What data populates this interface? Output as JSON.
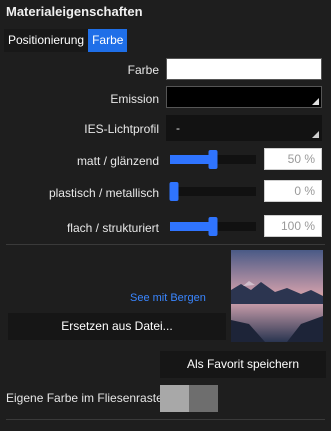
{
  "panel": {
    "title": "Materialeigenschaften"
  },
  "tabs": [
    {
      "label": "Positionierung",
      "active": false
    },
    {
      "label": "Farbe",
      "active": true
    }
  ],
  "properties": {
    "color": {
      "label": "Farbe",
      "value": "#ffffff"
    },
    "emission": {
      "label": "Emission",
      "value": "#000000"
    },
    "ies": {
      "label": "IES-Lichtprofil",
      "value": "-"
    }
  },
  "sliders": [
    {
      "label": "matt / glänzend",
      "value": 50,
      "display": "50 %"
    },
    {
      "label": "plastisch / metallisch",
      "value": 0,
      "display": "0 %"
    },
    {
      "label": "flach / strukturiert",
      "value": 50,
      "display": "100 %"
    }
  ],
  "texture": {
    "name": "See mit Bergen",
    "replace_label": "Ersetzen aus Datei...",
    "thumbnail_icon": "landscape-lake-mountains-image"
  },
  "favorite_label": "Als Favorit speichern",
  "tile_grid": {
    "label": "Eigene Farbe im Fliesenraster",
    "swatches": [
      "#a8a8a8",
      "#6e6e6e"
    ]
  },
  "colors": {
    "accent": "#1f6fe8",
    "link": "#3a86ff",
    "background": "#1e1e1e"
  }
}
